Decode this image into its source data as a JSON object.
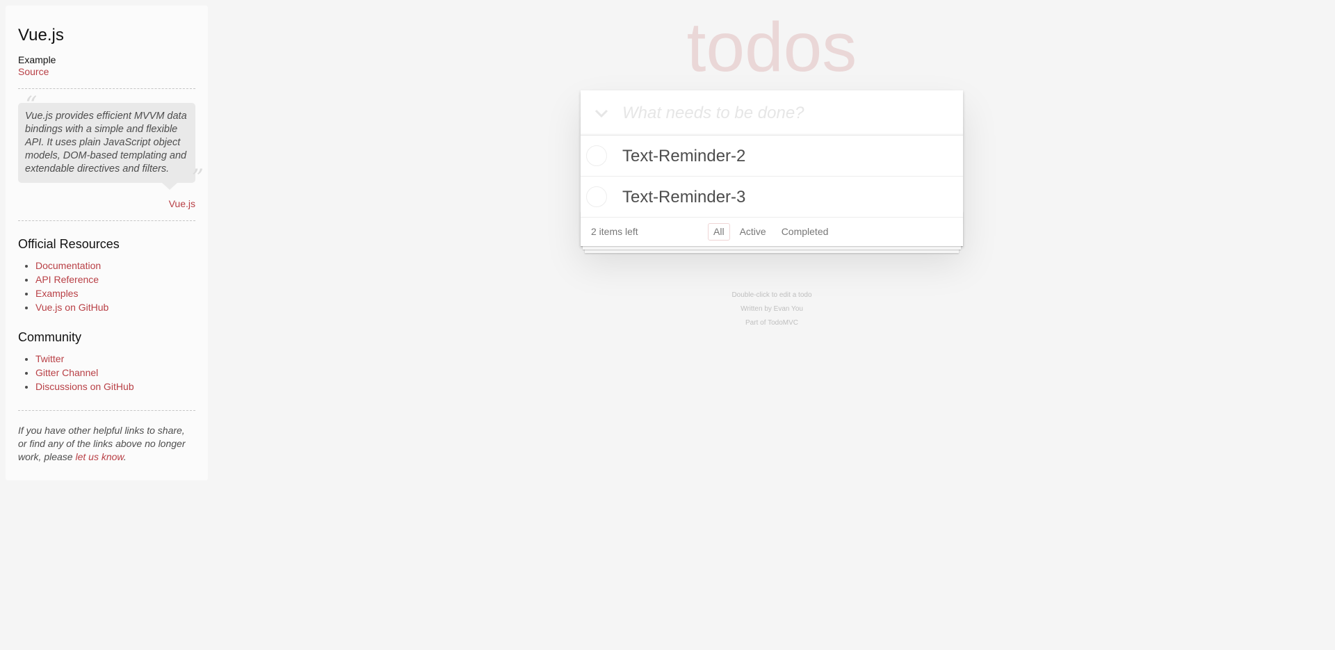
{
  "sidebar": {
    "title": "Vue.js",
    "example_label": "Example",
    "source_link": "Source",
    "quote": "Vue.js provides efficient MVVM data bindings with a simple and flexible API. It uses plain JavaScript object models, DOM-based templating and extendable directives and filters.",
    "quote_attribution": "Vue.js",
    "official_resources": {
      "heading": "Official Resources",
      "links": [
        "Documentation",
        "API Reference",
        "Examples",
        "Vue.js on GitHub"
      ]
    },
    "community": {
      "heading": "Community",
      "links": [
        "Twitter",
        "Gitter Channel",
        "Discussions on GitHub"
      ]
    },
    "footnote_before": "If you have other helpful links to share, or find any of the links above no longer work, please ",
    "footnote_link": "let us know",
    "footnote_after": "."
  },
  "app": {
    "title": "todos",
    "new_todo_placeholder": "What needs to be done?",
    "todos": [
      {
        "label": "Text-Reminder-2",
        "completed": false
      },
      {
        "label": "Text-Reminder-3",
        "completed": false
      }
    ],
    "items_left": "2 items left",
    "filters": [
      "All",
      "Active",
      "Completed"
    ],
    "selected_filter": "All"
  },
  "info": {
    "line1": "Double-click to edit a todo",
    "line2": "Written by Evan You",
    "line3": "Part of TodoMVC"
  },
  "colors": {
    "accent": "#b83f45",
    "background": "#f5f5f5",
    "title": "#ead7d7"
  }
}
